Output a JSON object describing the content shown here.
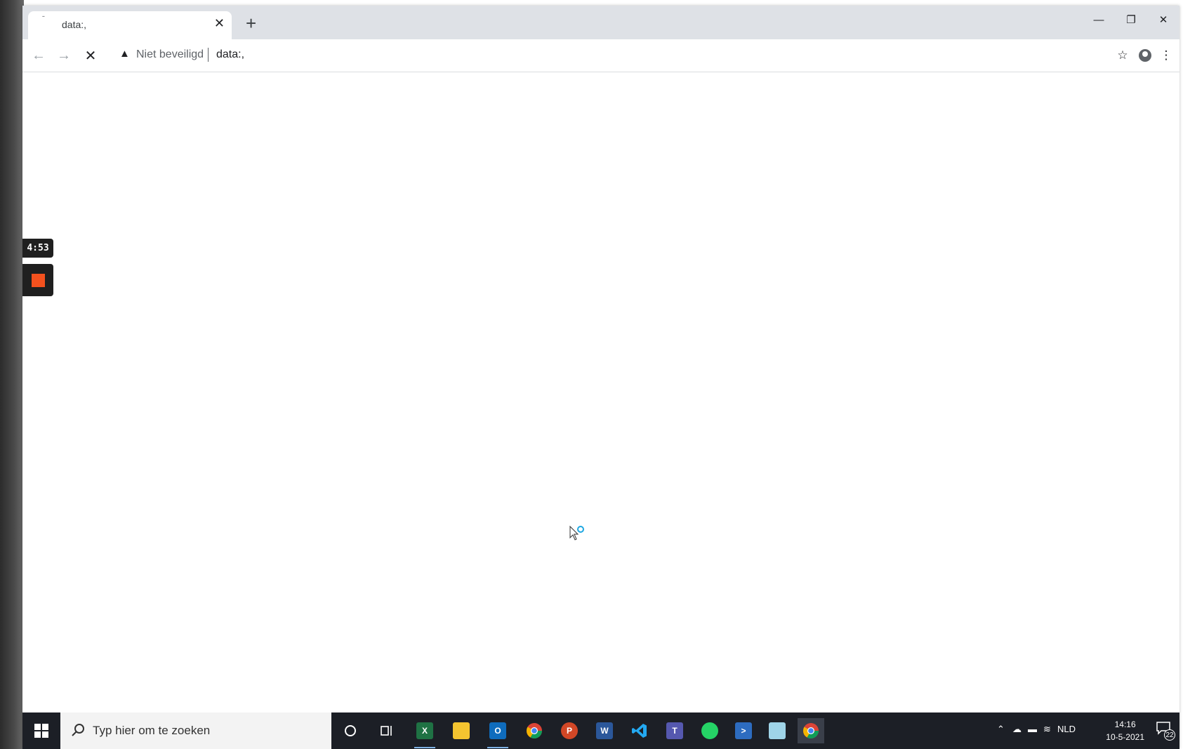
{
  "browser": {
    "tab": {
      "title": "data:,",
      "favicon": "loading-dot"
    },
    "security_text": "Niet beveiligd",
    "url": "data:,",
    "icons": {
      "back": "arrow-left-icon",
      "forward": "arrow-right-icon",
      "stop": "close-icon",
      "bookmark": "star-icon",
      "profile": "person-icon",
      "menu": "more-vert-icon"
    }
  },
  "recorder": {
    "timer": "4:53",
    "stop_color": "#f4511e"
  },
  "taskbar": {
    "search_placeholder": "Typ hier om te zoeken",
    "apps": [
      "cortana",
      "task-view",
      "excel",
      "file-explorer",
      "outlook",
      "chrome-profile",
      "powerpoint",
      "word",
      "vscode",
      "teams",
      "whatsapp",
      "powershell",
      "notepad",
      "chrome"
    ],
    "tray": {
      "language": "NLD",
      "time": "14:16",
      "date": "10-5-2021",
      "notification_count": "22"
    }
  }
}
